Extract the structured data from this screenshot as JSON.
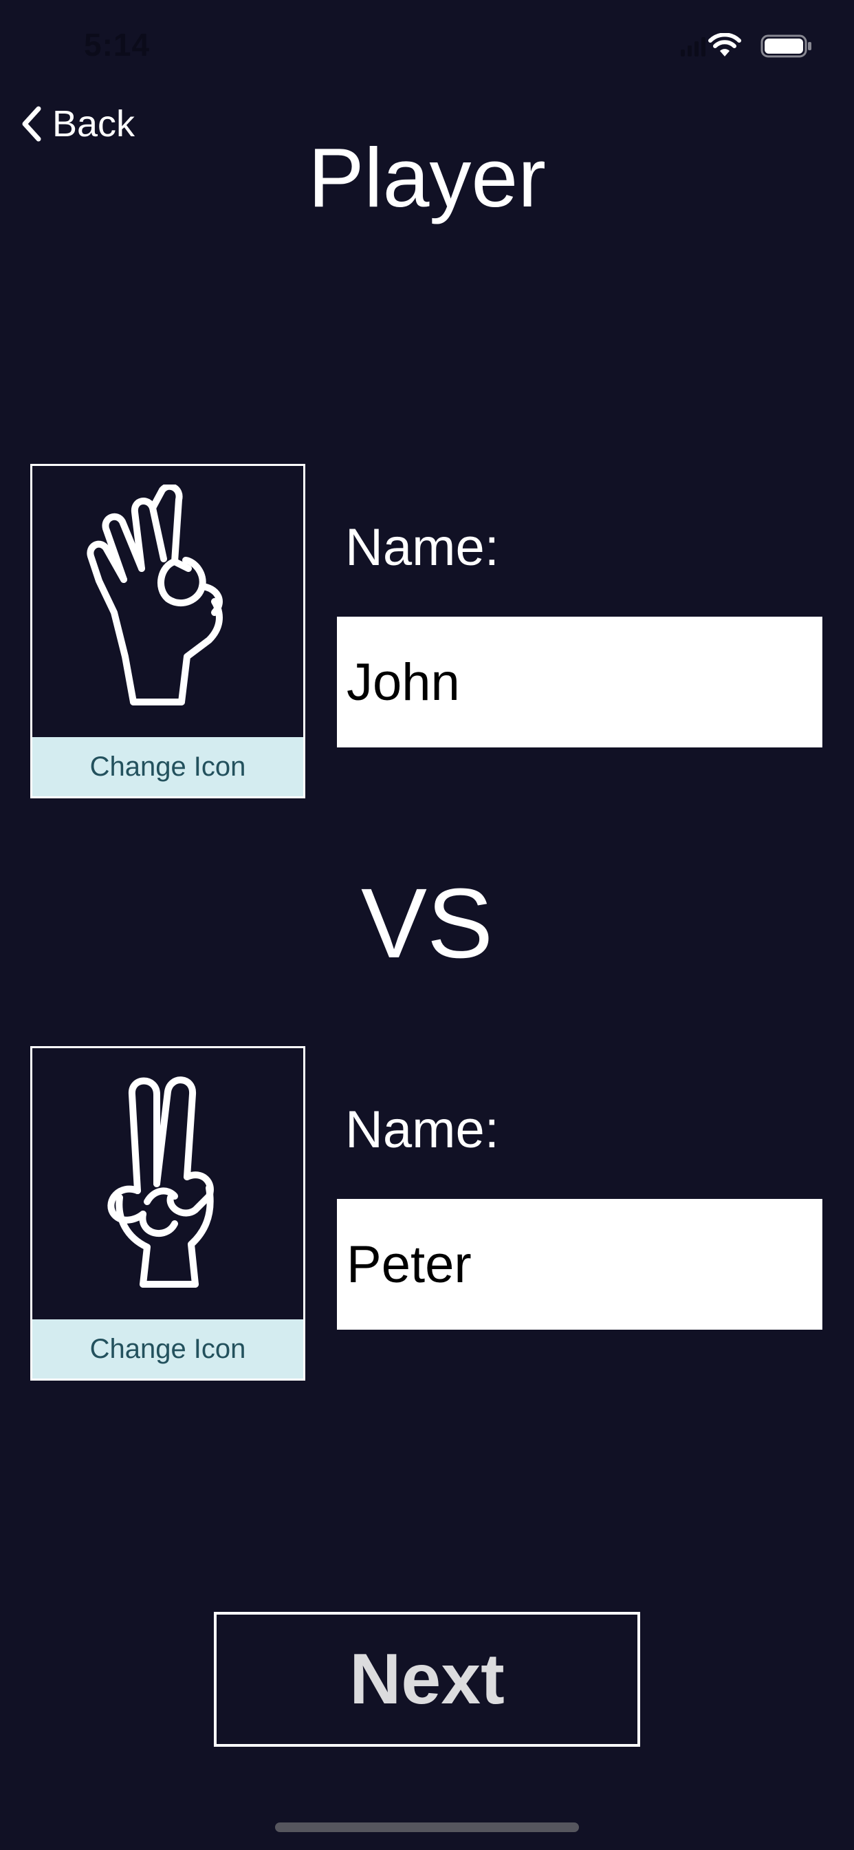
{
  "status_bar": {
    "time": "5:14",
    "icons": [
      "signal-icon",
      "wifi-icon",
      "battery-icon"
    ]
  },
  "nav": {
    "back_label": "Back"
  },
  "title": "Player",
  "players": [
    {
      "icon": "ok-hand-icon",
      "change_icon_label": "Change Icon",
      "name_label": "Name:",
      "name_value": "John"
    },
    {
      "icon": "peace-hand-icon",
      "change_icon_label": "Change Icon",
      "name_label": "Name:",
      "name_value": "Peter"
    }
  ],
  "vs_label": "VS",
  "next_label": "Next",
  "colors": {
    "background": "#111125",
    "change_icon_bg": "#d4ecf0",
    "change_icon_text": "#23515d",
    "field_bg": "#ffffff"
  }
}
